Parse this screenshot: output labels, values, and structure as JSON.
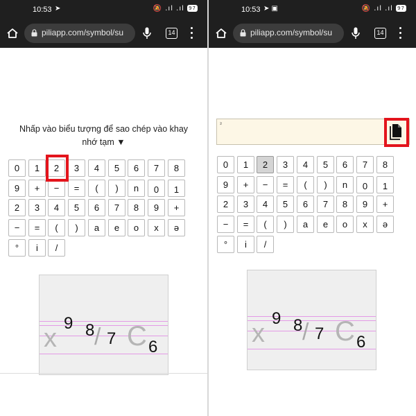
{
  "status_bar": {
    "left": {
      "time": "10:53",
      "icons": "➤"
    },
    "right": {
      "time": "10:53",
      "icons": "➤ ▣"
    },
    "system_icons": "🔕 .ıl .ıl ",
    "battery": "97"
  },
  "browser": {
    "url": "piliapp.com/symbol/su",
    "tab_count": "14",
    "icons": [
      "home-icon",
      "lock-icon",
      "mic-icon",
      "tabs-icon",
      "menu-icon"
    ]
  },
  "page": {
    "instruction_line1": "Nhấp vào biểu tượng để sao chép vào khay",
    "instruction_line2": "nhớ tạm ▼",
    "copied_value": "²"
  },
  "keys": [
    "0",
    "1",
    "2",
    "3",
    "4",
    "5",
    "6",
    "7",
    "8",
    "9",
    "+",
    "−",
    "=",
    "(",
    ")",
    "n",
    "0",
    "1",
    "2",
    "3",
    "4",
    "5",
    "6",
    "7",
    "8",
    "9",
    "+",
    "−",
    "=",
    "(",
    ")",
    "a",
    "e",
    "o",
    "x",
    "ə",
    "°",
    "i",
    "/"
  ],
  "highlight": {
    "left_key_index": 2,
    "right_selected_key_index": 2,
    "color": "#e3141c"
  },
  "preview": {
    "letter_x": "x",
    "sup_9": "9",
    "sup_8": "8",
    "slash": "/",
    "sub_7": "7",
    "letter_c": "C",
    "sub_6": "6",
    "guide_color": "#e39ae6"
  }
}
